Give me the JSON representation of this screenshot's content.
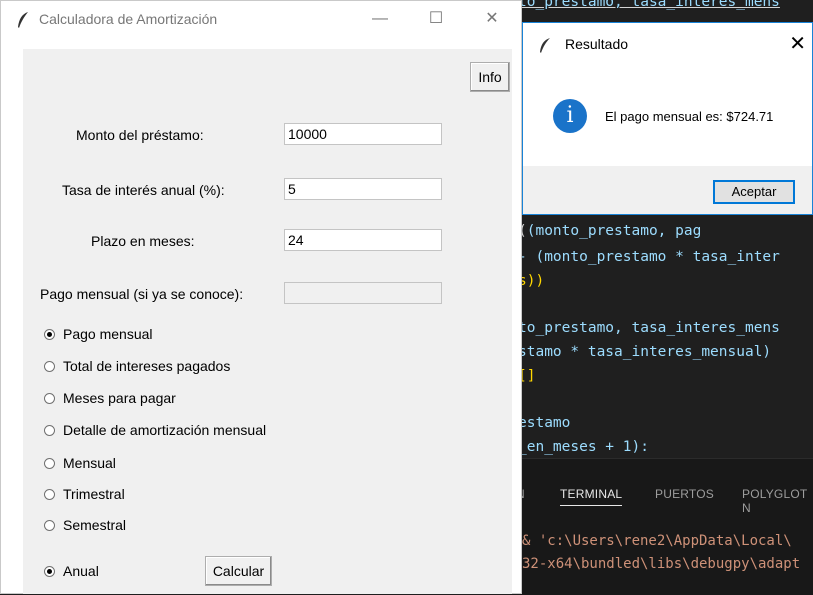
{
  "main_window": {
    "title": "Calculadora de Amortización",
    "info_button": "Info",
    "fields": [
      {
        "label": "Monto del préstamo:",
        "value": "10000"
      },
      {
        "label": "Tasa de interés anual (%):",
        "value": "5"
      },
      {
        "label": "Plazo en meses:",
        "value": "24"
      },
      {
        "label": "Pago mensual (si ya se conoce):",
        "value": ""
      }
    ],
    "options": [
      {
        "label": "Pago mensual",
        "selected": true
      },
      {
        "label": "Total de intereses pagados",
        "selected": false
      },
      {
        "label": "Meses para pagar",
        "selected": false
      },
      {
        "label": "Detalle de amortización mensual",
        "selected": false
      }
    ],
    "frequency_options": [
      {
        "label": "Mensual",
        "selected": false
      },
      {
        "label": "Trimestral",
        "selected": false
      },
      {
        "label": "Semestral",
        "selected": false
      },
      {
        "label": "Anual",
        "selected": true
      }
    ],
    "calculate_button": "Calcular"
  },
  "dialog": {
    "title": "Resultado",
    "icon": "info-icon",
    "message": "El pago mensual es: $724.71",
    "ok_button": "Aceptar"
  },
  "editor": {
    "lines": [
      "to_prestamo, tasa_interes_mens",
      "(monto_prestamo, pag",
      "- (monto_prestamo * tasa_inter",
      "s))",
      "to_prestamo, tasa_interes_mens",
      "stamo * tasa_interes_mensual)",
      "[]",
      "estamo",
      "_en_meses + 1):"
    ],
    "panel_tabs": [
      "N",
      "TERMINAL",
      "PUERTOS",
      "POLYGLOT N"
    ],
    "terminal_lines": [
      "& 'c:\\Users\\rene2\\AppData\\Local\\",
      "32-x64\\bundled\\libs\\debugpy\\adapt"
    ]
  }
}
